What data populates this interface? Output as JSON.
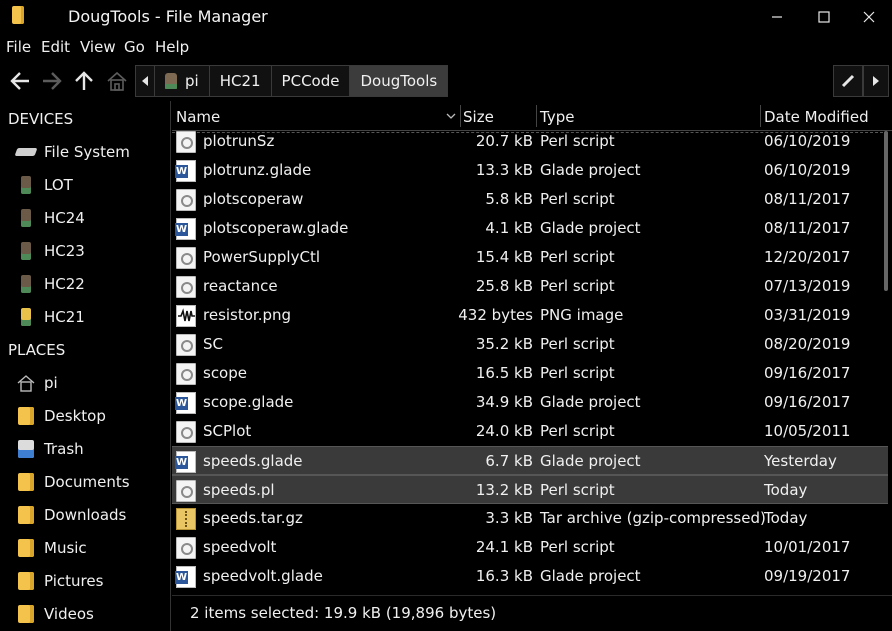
{
  "window": {
    "title": "DougTools - File Manager"
  },
  "menu": [
    "File",
    "Edit",
    "View",
    "Go",
    "Help"
  ],
  "path": [
    "pi",
    "HC21",
    "PCCode",
    "DougTools"
  ],
  "sidebar": {
    "devices_header": "DEVICES",
    "devices": [
      {
        "label": "File System",
        "icon": "drive-icon"
      },
      {
        "label": "LOT",
        "icon": "usb-drive-icon"
      },
      {
        "label": "HC24",
        "icon": "usb-drive-icon"
      },
      {
        "label": "HC23",
        "icon": "usb-drive-icon"
      },
      {
        "label": "HC22",
        "icon": "usb-drive-icon"
      },
      {
        "label": "HC21",
        "icon": "usb-drive-icon"
      }
    ],
    "places_header": "PLACES",
    "places": [
      {
        "label": "pi",
        "icon": "home-icon"
      },
      {
        "label": "Desktop",
        "icon": "folder-icon"
      },
      {
        "label": "Trash",
        "icon": "trash-icon"
      },
      {
        "label": "Documents",
        "icon": "folder-icon"
      },
      {
        "label": "Downloads",
        "icon": "folder-icon"
      },
      {
        "label": "Music",
        "icon": "folder-icon"
      },
      {
        "label": "Pictures",
        "icon": "folder-icon"
      },
      {
        "label": "Videos",
        "icon": "folder-icon"
      }
    ]
  },
  "columns": {
    "name": "Name",
    "size": "Size",
    "type": "Type",
    "date": "Date Modified"
  },
  "files": [
    {
      "name": "plotrunSz",
      "size": "20.7 kB",
      "type": "Perl script",
      "date": "06/10/2019",
      "kind": "perl",
      "selected": false
    },
    {
      "name": "plotrunz.glade",
      "size": "13.3 kB",
      "type": "Glade project",
      "date": "06/10/2019",
      "kind": "glade",
      "selected": false
    },
    {
      "name": "plotscoperaw",
      "size": "5.8 kB",
      "type": "Perl script",
      "date": "08/11/2017",
      "kind": "perl",
      "selected": false
    },
    {
      "name": "plotscoperaw.glade",
      "size": "4.1 kB",
      "type": "Glade project",
      "date": "08/11/2017",
      "kind": "glade",
      "selected": false
    },
    {
      "name": "PowerSupplyCtl",
      "size": "15.4 kB",
      "type": "Perl script",
      "date": "12/20/2017",
      "kind": "perl",
      "selected": false
    },
    {
      "name": "reactance",
      "size": "25.8 kB",
      "type": "Perl script",
      "date": "07/13/2019",
      "kind": "perl",
      "selected": false
    },
    {
      "name": "resistor.png",
      "size": "432 bytes",
      "type": "PNG image",
      "date": "03/31/2019",
      "kind": "png",
      "selected": false
    },
    {
      "name": "SC",
      "size": "35.2 kB",
      "type": "Perl script",
      "date": "08/20/2019",
      "kind": "perl",
      "selected": false
    },
    {
      "name": "scope",
      "size": "16.5 kB",
      "type": "Perl script",
      "date": "09/16/2017",
      "kind": "perl",
      "selected": false
    },
    {
      "name": "scope.glade",
      "size": "34.9 kB",
      "type": "Glade project",
      "date": "09/16/2017",
      "kind": "glade",
      "selected": false
    },
    {
      "name": "SCPlot",
      "size": "24.0 kB",
      "type": "Perl script",
      "date": "10/05/2011",
      "kind": "perl",
      "selected": false
    },
    {
      "name": "speeds.glade",
      "size": "6.7 kB",
      "type": "Glade project",
      "date": "Yesterday",
      "kind": "glade",
      "selected": true
    },
    {
      "name": "speeds.pl",
      "size": "13.2 kB",
      "type": "Perl script",
      "date": "Today",
      "kind": "perl",
      "selected": true
    },
    {
      "name": "speeds.tar.gz",
      "size": "3.3 kB",
      "type": "Tar archive (gzip-compressed)",
      "date": "Today",
      "kind": "tar",
      "selected": false
    },
    {
      "name": "speedvolt",
      "size": "24.1 kB",
      "type": "Perl script",
      "date": "10/01/2017",
      "kind": "perl",
      "selected": false
    },
    {
      "name": "speedvolt.glade",
      "size": "16.3 kB",
      "type": "Glade project",
      "date": "09/19/2017",
      "kind": "glade",
      "selected": false
    }
  ],
  "status": "2 items selected: 19.9 kB (19,896 bytes)"
}
